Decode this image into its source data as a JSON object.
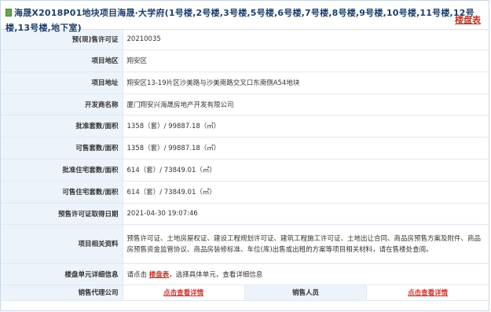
{
  "header": {
    "title": "海晟X2018P01地块项目海晟·大学府(1号楼,2号楼,3号楼,5号楼,6号楼,7号楼,8号楼,9号楼,10号楼,11号楼,12号楼,13号楼,地下室)",
    "link_label": "楼盘表"
  },
  "rows": [
    {
      "label": "预(现)售许可证",
      "value": "20210035"
    },
    {
      "label": "项目地区",
      "value": "翔安区"
    },
    {
      "label": "项目地址",
      "value": "翔安区13-19片区沙美路与沙美南路交叉口东南侧A54地块"
    },
    {
      "label": "开发商名称",
      "value": "厦门翔安兴海晟房地产开发有限公司"
    },
    {
      "label": "批准套数/面积",
      "value": "1358（套）/ 99887.18（㎡）"
    },
    {
      "label": "可售套数/面积",
      "value": "1358（套）/ 99887.18（㎡）"
    },
    {
      "label": "批准住宅套数/面积",
      "value": "614（套）/ 73849.01（㎡）"
    },
    {
      "label": "可售住宅套数/面积",
      "value": "614（套）/ 73849.01（㎡）"
    },
    {
      "label": "预售许可证取得日期",
      "value": "2021-04-30 19:07:46"
    },
    {
      "label": "项目相关资料",
      "value": "预售许可证、土地房屋权证、建设工程规划许可证、建筑工程施工许可证、土地出让合同、商品房预售方案及附件、商品房预售资金监管协议、商品房装修标准、车位(库)出售或出租的方案等项目相关材料，请在售楼处查阅。"
    },
    {
      "label": "楼盘单元详细信息",
      "value_prefix": "请点击",
      "value_link": "楼盘表",
      "value_suffix": "，选择具体单元，查看详细信息"
    }
  ],
  "bottom": {
    "agency_label": "销售代理公司",
    "agency_link": "点击查看详情",
    "staff_label": "销售人员",
    "staff_link": "点击查看详情"
  },
  "colors": {
    "label_bg": "#edf3fa",
    "link_red": "#c0392b",
    "title_blue": "#1d3e6b",
    "border": "#e2e8ef"
  },
  "icons": {
    "header": "document-icon"
  }
}
